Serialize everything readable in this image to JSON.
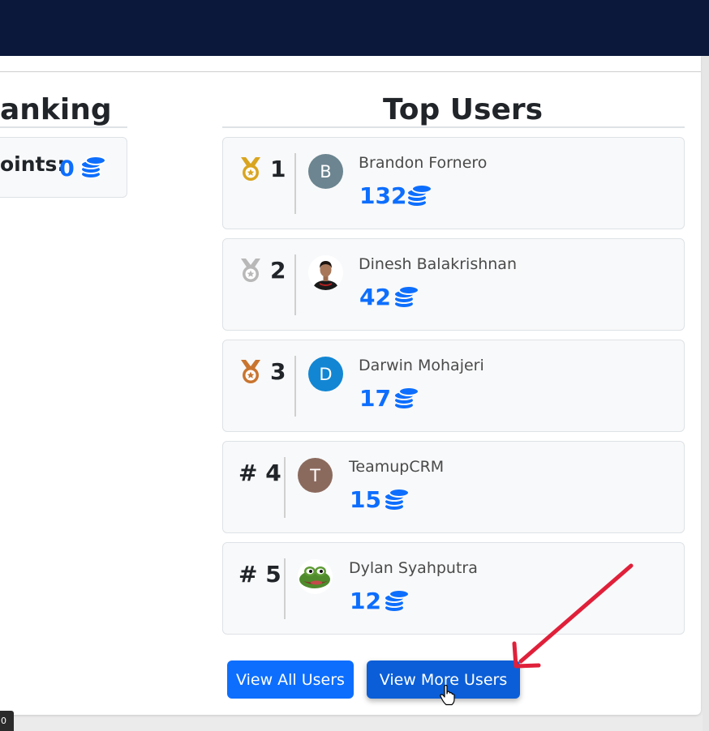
{
  "left_panel": {
    "title": "anking",
    "points_label": "oints:",
    "points_value": "0",
    "coin_icon": "coins-icon"
  },
  "top_users": {
    "title": "Top Users",
    "users": [
      {
        "rank": "1",
        "medal": "gold-medal-icon",
        "initial": "B",
        "avatar_color": "#6c8590",
        "name": "Brandon Fornero",
        "points": "132"
      },
      {
        "rank": "2",
        "medal": "silver-medal-icon",
        "initial": "",
        "avatar_color": "#ffffff",
        "name": "Dinesh Balakrishnan",
        "points": "42"
      },
      {
        "rank": "3",
        "medal": "bronze-medal-icon",
        "initial": "D",
        "avatar_color": "#1286d3",
        "name": "Darwin Mohajeri",
        "points": "17"
      },
      {
        "rank": "# 4",
        "medal": "",
        "initial": "T",
        "avatar_color": "#8b6a5e",
        "name": "TeamupCRM",
        "points": "15"
      },
      {
        "rank": "# 5",
        "medal": "",
        "initial": "",
        "avatar_color": "#ffffff",
        "name": "Dylan Syahputra",
        "points": "12"
      }
    ]
  },
  "buttons": {
    "view_all": "View All Users",
    "view_more": "View More Users"
  },
  "colors": {
    "header_bg": "#0b183b",
    "accent": "#0d6efd",
    "gold": "#d9a520",
    "silver": "#b8b8b8",
    "bronze": "#c9752f",
    "arrow": "#e0203a"
  },
  "status_badge": "0"
}
